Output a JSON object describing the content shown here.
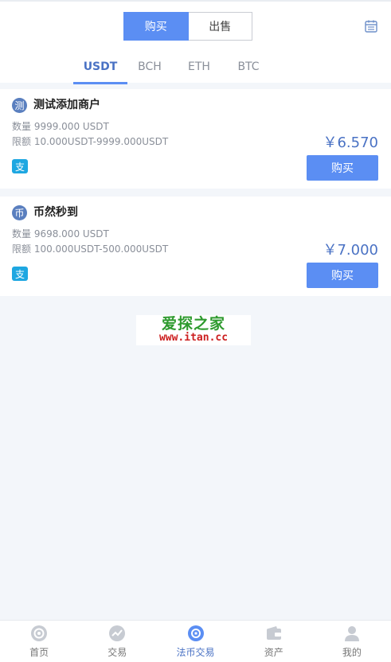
{
  "header": {
    "segments": [
      {
        "label": "购买"
      },
      {
        "label": "出售"
      }
    ],
    "coin_tabs": [
      {
        "label": "USDT"
      },
      {
        "label": "BCH"
      },
      {
        "label": "ETH"
      },
      {
        "label": "BTC"
      }
    ]
  },
  "offers": [
    {
      "icon_char": "测",
      "name": "测试添加商户",
      "quantity": "数量 9999.000 USDT",
      "limit": "限额 10.000USDT-9999.000USDT",
      "price": "￥6.570",
      "pay_icon_char": "支",
      "buy_label": "购买"
    },
    {
      "icon_char": "币",
      "name": "币然秒到",
      "quantity": "数量 9698.000 USDT",
      "limit": "限额 100.000USDT-500.000USDT",
      "price": "￥7.000",
      "pay_icon_char": "支",
      "buy_label": "购买"
    }
  ],
  "watermark": {
    "title": "爱探之家",
    "url": "www.itan.cc"
  },
  "nav": [
    {
      "label": "首页",
      "icon": "home-icon"
    },
    {
      "label": "交易",
      "icon": "trend-icon"
    },
    {
      "label": "法币交易",
      "icon": "fiat-icon"
    },
    {
      "label": "资产",
      "icon": "wallet-icon"
    },
    {
      "label": "我的",
      "icon": "user-icon"
    }
  ],
  "colors": {
    "accent": "#5b8ef3",
    "price": "#4a72c4",
    "background": "#f3f6fa"
  }
}
